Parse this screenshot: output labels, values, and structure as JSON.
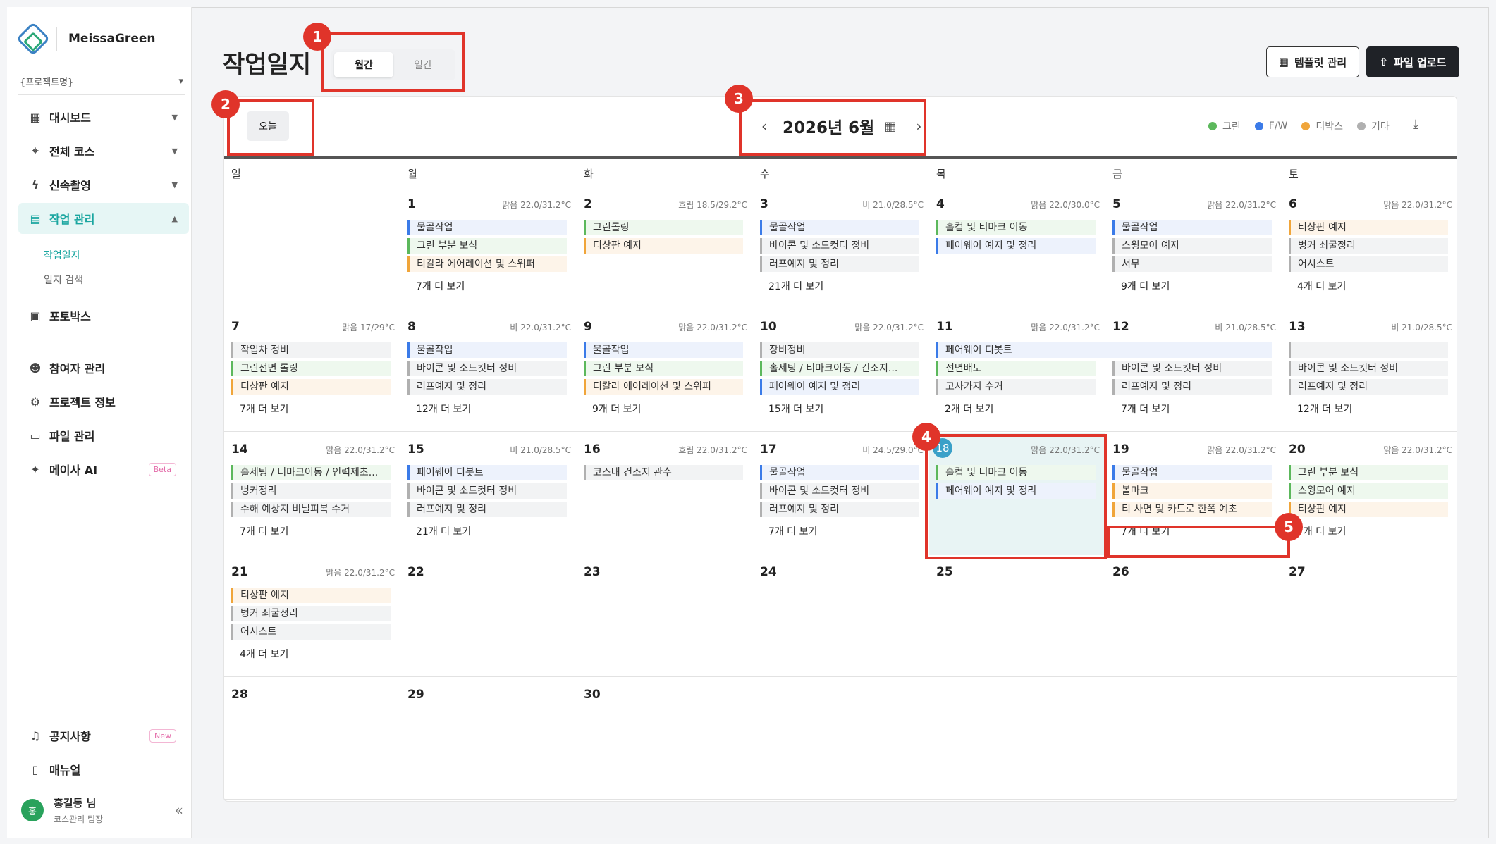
{
  "app": {
    "name": "MeissaGreen",
    "project_placeholder": "{프로젝트명}"
  },
  "sidebar": {
    "items": [
      {
        "label": "대시보드",
        "icon": "dashboard-icon"
      },
      {
        "label": "전체 코스",
        "icon": "course-icon"
      },
      {
        "label": "신속촬영",
        "icon": "flash-icon"
      },
      {
        "label": "작업 관리",
        "icon": "clipboard-icon",
        "active": true
      },
      {
        "label": "포토박스",
        "icon": "photo-icon"
      },
      {
        "label": "참여자 관리",
        "icon": "people-icon"
      },
      {
        "label": "프로젝트 정보",
        "icon": "gear-icon"
      },
      {
        "label": "파일 관리",
        "icon": "folder-icon"
      },
      {
        "label": "메이사 AI",
        "icon": "sparkle-icon",
        "badge": "Beta"
      }
    ],
    "subitems": [
      "작업일지",
      "일지 검색"
    ],
    "bottom": [
      {
        "label": "공지사항",
        "icon": "bell-icon",
        "badge": "New"
      },
      {
        "label": "매뉴얼",
        "icon": "book-icon"
      }
    ],
    "user": {
      "avatar": "홍",
      "name": "홍길동 님",
      "role": "코스관리 팀장",
      "collapse": "«"
    }
  },
  "header": {
    "title": "작업일지",
    "view_tabs": [
      "월간",
      "일간"
    ],
    "template_button": "템플릿 관리",
    "upload_button": "파일 업로드"
  },
  "toolbar": {
    "today_button": "오늘",
    "month_label": "2026년 6월",
    "legend": [
      {
        "label": "그린",
        "color": "#5cb85c"
      },
      {
        "label": "F/W",
        "color": "#3b7be8"
      },
      {
        "label": "티박스",
        "color": "#f0a53a"
      },
      {
        "label": "기타",
        "color": "#b0b0b0"
      }
    ]
  },
  "weekdays": [
    "일",
    "월",
    "화",
    "수",
    "목",
    "금",
    "토"
  ],
  "colors": {
    "G": "#5cb85c",
    "F": "#3b7be8",
    "T": "#f0a53a",
    "E": "#b0b0b0"
  },
  "days": [
    {
      "d": "1",
      "wx": "맑음 22.0/31.2°C",
      "ev": [
        [
          "F",
          "물골작업"
        ],
        [
          "G",
          "그린 부분 보식"
        ],
        [
          "T",
          "티칼라 에어레이션 및 스위퍼"
        ]
      ],
      "more": "7개 더 보기"
    },
    {
      "d": "2",
      "wx": "흐림 18.5/29.2°C",
      "ev": [
        [
          "G",
          "그린롤링"
        ],
        [
          "T",
          "티상판 예지"
        ]
      ],
      "more": ""
    },
    {
      "d": "3",
      "wx": "비 21.0/28.5°C",
      "ev": [
        [
          "F",
          "물골작업"
        ],
        [
          "E",
          "바이콘 및 소드컷터 정비"
        ],
        [
          "E",
          "러프예지 및 정리"
        ]
      ],
      "more": "21개 더 보기"
    },
    {
      "d": "4",
      "wx": "맑음 22.0/30.0°C",
      "ev": [
        [
          "G",
          "홀컵 및 티마크 이동"
        ],
        [
          "F",
          "페어웨이 예지 및 정리"
        ]
      ],
      "more": ""
    },
    {
      "d": "5",
      "wx": "맑음 22.0/31.2°C",
      "ev": [
        [
          "F",
          "물골작업"
        ],
        [
          "E",
          "스윙모어 예지"
        ],
        [
          "E",
          "서무"
        ]
      ],
      "more": "9개 더 보기"
    },
    {
      "d": "6",
      "wx": "맑음 22.0/31.2°C",
      "ev": [
        [
          "T",
          "티상판 예지"
        ],
        [
          "E",
          "벙커 쇠굴정리"
        ],
        [
          "E",
          "어시스트"
        ]
      ],
      "more": "4개 더 보기"
    },
    {
      "d": "7",
      "wx": "맑음 17/29°C",
      "ev": [
        [
          "E",
          "작업차 정비"
        ],
        [
          "G",
          "그린전면 롤링"
        ],
        [
          "T",
          "티상판 예지"
        ]
      ],
      "more": "7개 더 보기"
    },
    {
      "d": "8",
      "wx": "비 22.0/31.2°C",
      "ev": [
        [
          "F",
          "물골작업"
        ],
        [
          "E",
          "바이콘 및 소드컷터 정비"
        ],
        [
          "E",
          "러프예지 및 정리"
        ]
      ],
      "more": "12개 더 보기"
    },
    {
      "d": "9",
      "wx": "맑음 22.0/31.2°C",
      "ev": [
        [
          "F",
          "물골작업"
        ],
        [
          "G",
          "그린 부분 보식"
        ],
        [
          "T",
          "티칼라 에어레이션 및 스위퍼"
        ]
      ],
      "more": "9개 더 보기"
    },
    {
      "d": "10",
      "wx": "맑음 22.0/31.2°C",
      "ev": [
        [
          "E",
          "장비정비"
        ],
        [
          "G",
          "홀세팅 / 티마크이동 / 건조지..."
        ],
        [
          "F",
          "페어웨이 예지 및 정리"
        ]
      ],
      "more": "15개 더 보기"
    },
    {
      "d": "11",
      "wx": "맑음 22.0/31.2°C",
      "ev": [
        [
          "F",
          "페어웨이 디봇트"
        ],
        [
          "G",
          "전면배토"
        ],
        [
          "E",
          "고사가지 수거"
        ]
      ],
      "more": "2개 더 보기"
    },
    {
      "d": "12",
      "wx": "비 21.0/28.5°C",
      "ev": [
        [
          "E",
          ""
        ],
        [
          "E",
          "바이콘 및 소드컷터 정비"
        ],
        [
          "E",
          "러프예지 및 정리"
        ]
      ],
      "more": "7개 더 보기"
    },
    {
      "d": "13",
      "wx": "비 21.0/28.5°C",
      "ev": [
        [
          "E",
          ""
        ],
        [
          "E",
          "바이콘 및 소드컷터 정비"
        ],
        [
          "E",
          "러프예지 및 정리"
        ]
      ],
      "more": "12개 더 보기"
    },
    {
      "d": "14",
      "wx": "맑음 22.0/31.2°C",
      "ev": [
        [
          "G",
          "홀세팅 / 티마크이동 / 인력제초..."
        ],
        [
          "E",
          "벙커정리"
        ],
        [
          "E",
          "수해 예상지 비닐피복 수거"
        ]
      ],
      "more": "7개 더 보기"
    },
    {
      "d": "15",
      "wx": "비 21.0/28.5°C",
      "ev": [
        [
          "F",
          "페어웨이 디봇트"
        ],
        [
          "E",
          "바이콘 및 소드컷터 정비"
        ],
        [
          "E",
          "러프예지 및 정리"
        ]
      ],
      "more": "21개 더 보기"
    },
    {
      "d": "16",
      "wx": "흐림 22.0/31.2°C",
      "ev": [
        [
          "E",
          "코스내 건조지 관수"
        ]
      ],
      "more": ""
    },
    {
      "d": "17",
      "wx": "비 24.5/29.0°C",
      "ev": [
        [
          "F",
          "물골작업"
        ],
        [
          "E",
          "바이콘 및 소드컷터 정비"
        ],
        [
          "E",
          "러프예지 및 정리"
        ]
      ],
      "more": "7개 더 보기"
    },
    {
      "d": "18",
      "wx": "맑음 22.0/31.2°C",
      "ev": [
        [
          "G",
          "홀컵 및 티마크 이동"
        ],
        [
          "F",
          "페어웨이 예지 및 정리"
        ]
      ],
      "more": "",
      "today": true
    },
    {
      "d": "19",
      "wx": "맑음 22.0/31.2°C",
      "ev": [
        [
          "F",
          "물골작업"
        ],
        [
          "T",
          "볼마크"
        ],
        [
          "T",
          "티 사면 및 카트로 한쪽 예초"
        ]
      ],
      "more": "7개 더 보기"
    },
    {
      "d": "20",
      "wx": "맑음 22.0/31.2°C",
      "ev": [
        [
          "G",
          "그린 부분 보식"
        ],
        [
          "G",
          "스윙모어 예지"
        ],
        [
          "T",
          "티상판 예지"
        ]
      ],
      "more": "7개 더 보기"
    },
    {
      "d": "21",
      "wx": "맑음 22.0/31.2°C",
      "ev": [
        [
          "T",
          "티상판 예지"
        ],
        [
          "E",
          "벙커 쇠굴정리"
        ],
        [
          "E",
          "어시스트"
        ]
      ],
      "more": "4개 더 보기"
    },
    {
      "d": "22",
      "wx": "",
      "ev": [],
      "more": ""
    },
    {
      "d": "23",
      "wx": "",
      "ev": [],
      "more": ""
    },
    {
      "d": "24",
      "wx": "",
      "ev": [],
      "more": ""
    },
    {
      "d": "25",
      "wx": "",
      "ev": [],
      "more": ""
    },
    {
      "d": "26",
      "wx": "",
      "ev": [],
      "more": ""
    },
    {
      "d": "27",
      "wx": "",
      "ev": [],
      "more": ""
    },
    {
      "d": "28",
      "wx": "",
      "ev": [],
      "more": ""
    },
    {
      "d": "29",
      "wx": "",
      "ev": [],
      "more": ""
    },
    {
      "d": "30",
      "wx": "",
      "ev": [],
      "more": ""
    }
  ],
  "callouts": [
    "1",
    "2",
    "3",
    "4",
    "5"
  ]
}
